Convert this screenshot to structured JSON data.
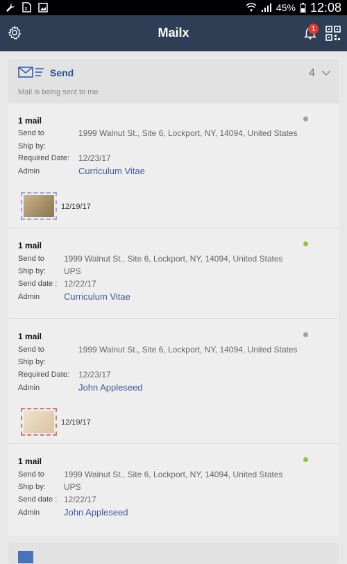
{
  "status": {
    "battery": "45%",
    "time": "12:08"
  },
  "app": {
    "title": "Mailx",
    "notification_count": "1"
  },
  "section": {
    "title": "Send",
    "count": "4",
    "subtitle": "Mail is being sent to me"
  },
  "items": [
    {
      "name": "1 mail",
      "status_color": "#9e9e9e",
      "send_to_label": "Send to",
      "send_to": "1999 Walnut St., Site 6, Lockport, NY, 14094, United States",
      "ship_by_label": "Ship by:",
      "ship_by": "",
      "date_label": "Required Date:",
      "date": "12/23/17",
      "admin_label": "Admin",
      "admin": "Curriculum Vitae",
      "attachment_date": "12/19/17"
    },
    {
      "name": "1 mail",
      "status_color": "#8bc34a",
      "send_to_label": "Send to",
      "send_to": "1999 Walnut St., Site 6, Lockport, NY, 14094, United States",
      "ship_by_label": "Ship by:",
      "ship_by": "UPS",
      "date_label": "Send date :",
      "date": "12/22/17",
      "admin_label": "Admin",
      "admin": "Curriculum Vitae"
    },
    {
      "name": "1 mail",
      "status_color": "#9e9e9e",
      "send_to_label": "Send to",
      "send_to": "1999 Walnut St., Site 6, Lockport, NY, 14094, United States",
      "ship_by_label": "Ship by:",
      "ship_by": "",
      "date_label": "Required Date:",
      "date": "12/23/17",
      "admin_label": "Admin",
      "admin": "John Appleseed",
      "attachment_date": "12/19/17"
    },
    {
      "name": "1 mail",
      "status_color": "#8bc34a",
      "send_to_label": "Send to",
      "send_to": "1999 Walnut St., Site 6, Lockport, NY, 14094, United States",
      "ship_by_label": "Ship by:",
      "ship_by": "UPS",
      "date_label": "Send date :",
      "date": "12/22/17",
      "admin_label": "Admin",
      "admin": "John Appleseed"
    }
  ]
}
